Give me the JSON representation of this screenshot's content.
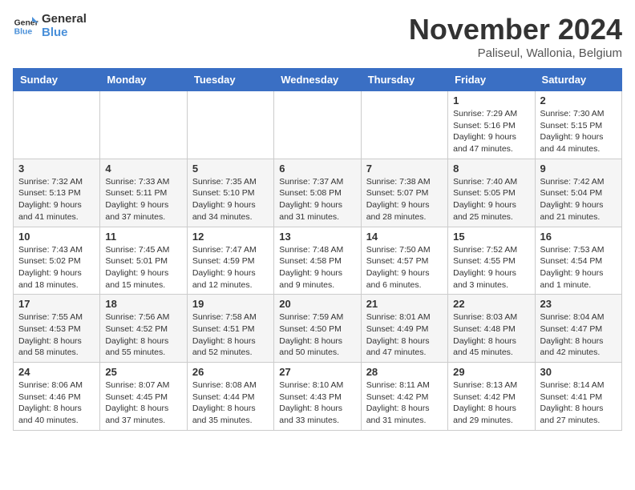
{
  "logo": {
    "text1": "General",
    "text2": "Blue"
  },
  "title": "November 2024",
  "subtitle": "Paliseul, Wallonia, Belgium",
  "weekdays": [
    "Sunday",
    "Monday",
    "Tuesday",
    "Wednesday",
    "Thursday",
    "Friday",
    "Saturday"
  ],
  "weeks": [
    [
      {
        "day": "",
        "info": ""
      },
      {
        "day": "",
        "info": ""
      },
      {
        "day": "",
        "info": ""
      },
      {
        "day": "",
        "info": ""
      },
      {
        "day": "",
        "info": ""
      },
      {
        "day": "1",
        "info": "Sunrise: 7:29 AM\nSunset: 5:16 PM\nDaylight: 9 hours\nand 47 minutes."
      },
      {
        "day": "2",
        "info": "Sunrise: 7:30 AM\nSunset: 5:15 PM\nDaylight: 9 hours\nand 44 minutes."
      }
    ],
    [
      {
        "day": "3",
        "info": "Sunrise: 7:32 AM\nSunset: 5:13 PM\nDaylight: 9 hours\nand 41 minutes."
      },
      {
        "day": "4",
        "info": "Sunrise: 7:33 AM\nSunset: 5:11 PM\nDaylight: 9 hours\nand 37 minutes."
      },
      {
        "day": "5",
        "info": "Sunrise: 7:35 AM\nSunset: 5:10 PM\nDaylight: 9 hours\nand 34 minutes."
      },
      {
        "day": "6",
        "info": "Sunrise: 7:37 AM\nSunset: 5:08 PM\nDaylight: 9 hours\nand 31 minutes."
      },
      {
        "day": "7",
        "info": "Sunrise: 7:38 AM\nSunset: 5:07 PM\nDaylight: 9 hours\nand 28 minutes."
      },
      {
        "day": "8",
        "info": "Sunrise: 7:40 AM\nSunset: 5:05 PM\nDaylight: 9 hours\nand 25 minutes."
      },
      {
        "day": "9",
        "info": "Sunrise: 7:42 AM\nSunset: 5:04 PM\nDaylight: 9 hours\nand 21 minutes."
      }
    ],
    [
      {
        "day": "10",
        "info": "Sunrise: 7:43 AM\nSunset: 5:02 PM\nDaylight: 9 hours\nand 18 minutes."
      },
      {
        "day": "11",
        "info": "Sunrise: 7:45 AM\nSunset: 5:01 PM\nDaylight: 9 hours\nand 15 minutes."
      },
      {
        "day": "12",
        "info": "Sunrise: 7:47 AM\nSunset: 4:59 PM\nDaylight: 9 hours\nand 12 minutes."
      },
      {
        "day": "13",
        "info": "Sunrise: 7:48 AM\nSunset: 4:58 PM\nDaylight: 9 hours\nand 9 minutes."
      },
      {
        "day": "14",
        "info": "Sunrise: 7:50 AM\nSunset: 4:57 PM\nDaylight: 9 hours\nand 6 minutes."
      },
      {
        "day": "15",
        "info": "Sunrise: 7:52 AM\nSunset: 4:55 PM\nDaylight: 9 hours\nand 3 minutes."
      },
      {
        "day": "16",
        "info": "Sunrise: 7:53 AM\nSunset: 4:54 PM\nDaylight: 9 hours\nand 1 minute."
      }
    ],
    [
      {
        "day": "17",
        "info": "Sunrise: 7:55 AM\nSunset: 4:53 PM\nDaylight: 8 hours\nand 58 minutes."
      },
      {
        "day": "18",
        "info": "Sunrise: 7:56 AM\nSunset: 4:52 PM\nDaylight: 8 hours\nand 55 minutes."
      },
      {
        "day": "19",
        "info": "Sunrise: 7:58 AM\nSunset: 4:51 PM\nDaylight: 8 hours\nand 52 minutes."
      },
      {
        "day": "20",
        "info": "Sunrise: 7:59 AM\nSunset: 4:50 PM\nDaylight: 8 hours\nand 50 minutes."
      },
      {
        "day": "21",
        "info": "Sunrise: 8:01 AM\nSunset: 4:49 PM\nDaylight: 8 hours\nand 47 minutes."
      },
      {
        "day": "22",
        "info": "Sunrise: 8:03 AM\nSunset: 4:48 PM\nDaylight: 8 hours\nand 45 minutes."
      },
      {
        "day": "23",
        "info": "Sunrise: 8:04 AM\nSunset: 4:47 PM\nDaylight: 8 hours\nand 42 minutes."
      }
    ],
    [
      {
        "day": "24",
        "info": "Sunrise: 8:06 AM\nSunset: 4:46 PM\nDaylight: 8 hours\nand 40 minutes."
      },
      {
        "day": "25",
        "info": "Sunrise: 8:07 AM\nSunset: 4:45 PM\nDaylight: 8 hours\nand 37 minutes."
      },
      {
        "day": "26",
        "info": "Sunrise: 8:08 AM\nSunset: 4:44 PM\nDaylight: 8 hours\nand 35 minutes."
      },
      {
        "day": "27",
        "info": "Sunrise: 8:10 AM\nSunset: 4:43 PM\nDaylight: 8 hours\nand 33 minutes."
      },
      {
        "day": "28",
        "info": "Sunrise: 8:11 AM\nSunset: 4:42 PM\nDaylight: 8 hours\nand 31 minutes."
      },
      {
        "day": "29",
        "info": "Sunrise: 8:13 AM\nSunset: 4:42 PM\nDaylight: 8 hours\nand 29 minutes."
      },
      {
        "day": "30",
        "info": "Sunrise: 8:14 AM\nSunset: 4:41 PM\nDaylight: 8 hours\nand 27 minutes."
      }
    ]
  ]
}
